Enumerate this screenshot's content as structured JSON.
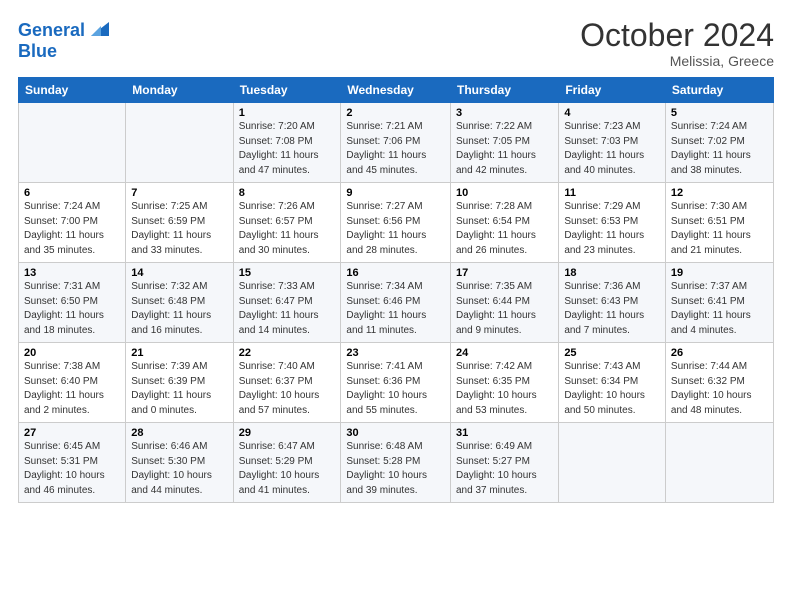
{
  "header": {
    "logo_general": "General",
    "logo_blue": "Blue",
    "month": "October 2024",
    "location": "Melissia, Greece"
  },
  "weekdays": [
    "Sunday",
    "Monday",
    "Tuesday",
    "Wednesday",
    "Thursday",
    "Friday",
    "Saturday"
  ],
  "weeks": [
    [
      {
        "day": "",
        "sunrise": "",
        "sunset": "",
        "daylight": ""
      },
      {
        "day": "",
        "sunrise": "",
        "sunset": "",
        "daylight": ""
      },
      {
        "day": "1",
        "sunrise": "Sunrise: 7:20 AM",
        "sunset": "Sunset: 7:08 PM",
        "daylight": "Daylight: 11 hours and 47 minutes."
      },
      {
        "day": "2",
        "sunrise": "Sunrise: 7:21 AM",
        "sunset": "Sunset: 7:06 PM",
        "daylight": "Daylight: 11 hours and 45 minutes."
      },
      {
        "day": "3",
        "sunrise": "Sunrise: 7:22 AM",
        "sunset": "Sunset: 7:05 PM",
        "daylight": "Daylight: 11 hours and 42 minutes."
      },
      {
        "day": "4",
        "sunrise": "Sunrise: 7:23 AM",
        "sunset": "Sunset: 7:03 PM",
        "daylight": "Daylight: 11 hours and 40 minutes."
      },
      {
        "day": "5",
        "sunrise": "Sunrise: 7:24 AM",
        "sunset": "Sunset: 7:02 PM",
        "daylight": "Daylight: 11 hours and 38 minutes."
      }
    ],
    [
      {
        "day": "6",
        "sunrise": "Sunrise: 7:24 AM",
        "sunset": "Sunset: 7:00 PM",
        "daylight": "Daylight: 11 hours and 35 minutes."
      },
      {
        "day": "7",
        "sunrise": "Sunrise: 7:25 AM",
        "sunset": "Sunset: 6:59 PM",
        "daylight": "Daylight: 11 hours and 33 minutes."
      },
      {
        "day": "8",
        "sunrise": "Sunrise: 7:26 AM",
        "sunset": "Sunset: 6:57 PM",
        "daylight": "Daylight: 11 hours and 30 minutes."
      },
      {
        "day": "9",
        "sunrise": "Sunrise: 7:27 AM",
        "sunset": "Sunset: 6:56 PM",
        "daylight": "Daylight: 11 hours and 28 minutes."
      },
      {
        "day": "10",
        "sunrise": "Sunrise: 7:28 AM",
        "sunset": "Sunset: 6:54 PM",
        "daylight": "Daylight: 11 hours and 26 minutes."
      },
      {
        "day": "11",
        "sunrise": "Sunrise: 7:29 AM",
        "sunset": "Sunset: 6:53 PM",
        "daylight": "Daylight: 11 hours and 23 minutes."
      },
      {
        "day": "12",
        "sunrise": "Sunrise: 7:30 AM",
        "sunset": "Sunset: 6:51 PM",
        "daylight": "Daylight: 11 hours and 21 minutes."
      }
    ],
    [
      {
        "day": "13",
        "sunrise": "Sunrise: 7:31 AM",
        "sunset": "Sunset: 6:50 PM",
        "daylight": "Daylight: 11 hours and 18 minutes."
      },
      {
        "day": "14",
        "sunrise": "Sunrise: 7:32 AM",
        "sunset": "Sunset: 6:48 PM",
        "daylight": "Daylight: 11 hours and 16 minutes."
      },
      {
        "day": "15",
        "sunrise": "Sunrise: 7:33 AM",
        "sunset": "Sunset: 6:47 PM",
        "daylight": "Daylight: 11 hours and 14 minutes."
      },
      {
        "day": "16",
        "sunrise": "Sunrise: 7:34 AM",
        "sunset": "Sunset: 6:46 PM",
        "daylight": "Daylight: 11 hours and 11 minutes."
      },
      {
        "day": "17",
        "sunrise": "Sunrise: 7:35 AM",
        "sunset": "Sunset: 6:44 PM",
        "daylight": "Daylight: 11 hours and 9 minutes."
      },
      {
        "day": "18",
        "sunrise": "Sunrise: 7:36 AM",
        "sunset": "Sunset: 6:43 PM",
        "daylight": "Daylight: 11 hours and 7 minutes."
      },
      {
        "day": "19",
        "sunrise": "Sunrise: 7:37 AM",
        "sunset": "Sunset: 6:41 PM",
        "daylight": "Daylight: 11 hours and 4 minutes."
      }
    ],
    [
      {
        "day": "20",
        "sunrise": "Sunrise: 7:38 AM",
        "sunset": "Sunset: 6:40 PM",
        "daylight": "Daylight: 11 hours and 2 minutes."
      },
      {
        "day": "21",
        "sunrise": "Sunrise: 7:39 AM",
        "sunset": "Sunset: 6:39 PM",
        "daylight": "Daylight: 11 hours and 0 minutes."
      },
      {
        "day": "22",
        "sunrise": "Sunrise: 7:40 AM",
        "sunset": "Sunset: 6:37 PM",
        "daylight": "Daylight: 10 hours and 57 minutes."
      },
      {
        "day": "23",
        "sunrise": "Sunrise: 7:41 AM",
        "sunset": "Sunset: 6:36 PM",
        "daylight": "Daylight: 10 hours and 55 minutes."
      },
      {
        "day": "24",
        "sunrise": "Sunrise: 7:42 AM",
        "sunset": "Sunset: 6:35 PM",
        "daylight": "Daylight: 10 hours and 53 minutes."
      },
      {
        "day": "25",
        "sunrise": "Sunrise: 7:43 AM",
        "sunset": "Sunset: 6:34 PM",
        "daylight": "Daylight: 10 hours and 50 minutes."
      },
      {
        "day": "26",
        "sunrise": "Sunrise: 7:44 AM",
        "sunset": "Sunset: 6:32 PM",
        "daylight": "Daylight: 10 hours and 48 minutes."
      }
    ],
    [
      {
        "day": "27",
        "sunrise": "Sunrise: 6:45 AM",
        "sunset": "Sunset: 5:31 PM",
        "daylight": "Daylight: 10 hours and 46 minutes."
      },
      {
        "day": "28",
        "sunrise": "Sunrise: 6:46 AM",
        "sunset": "Sunset: 5:30 PM",
        "daylight": "Daylight: 10 hours and 44 minutes."
      },
      {
        "day": "29",
        "sunrise": "Sunrise: 6:47 AM",
        "sunset": "Sunset: 5:29 PM",
        "daylight": "Daylight: 10 hours and 41 minutes."
      },
      {
        "day": "30",
        "sunrise": "Sunrise: 6:48 AM",
        "sunset": "Sunset: 5:28 PM",
        "daylight": "Daylight: 10 hours and 39 minutes."
      },
      {
        "day": "31",
        "sunrise": "Sunrise: 6:49 AM",
        "sunset": "Sunset: 5:27 PM",
        "daylight": "Daylight: 10 hours and 37 minutes."
      },
      {
        "day": "",
        "sunrise": "",
        "sunset": "",
        "daylight": ""
      },
      {
        "day": "",
        "sunrise": "",
        "sunset": "",
        "daylight": ""
      }
    ]
  ]
}
